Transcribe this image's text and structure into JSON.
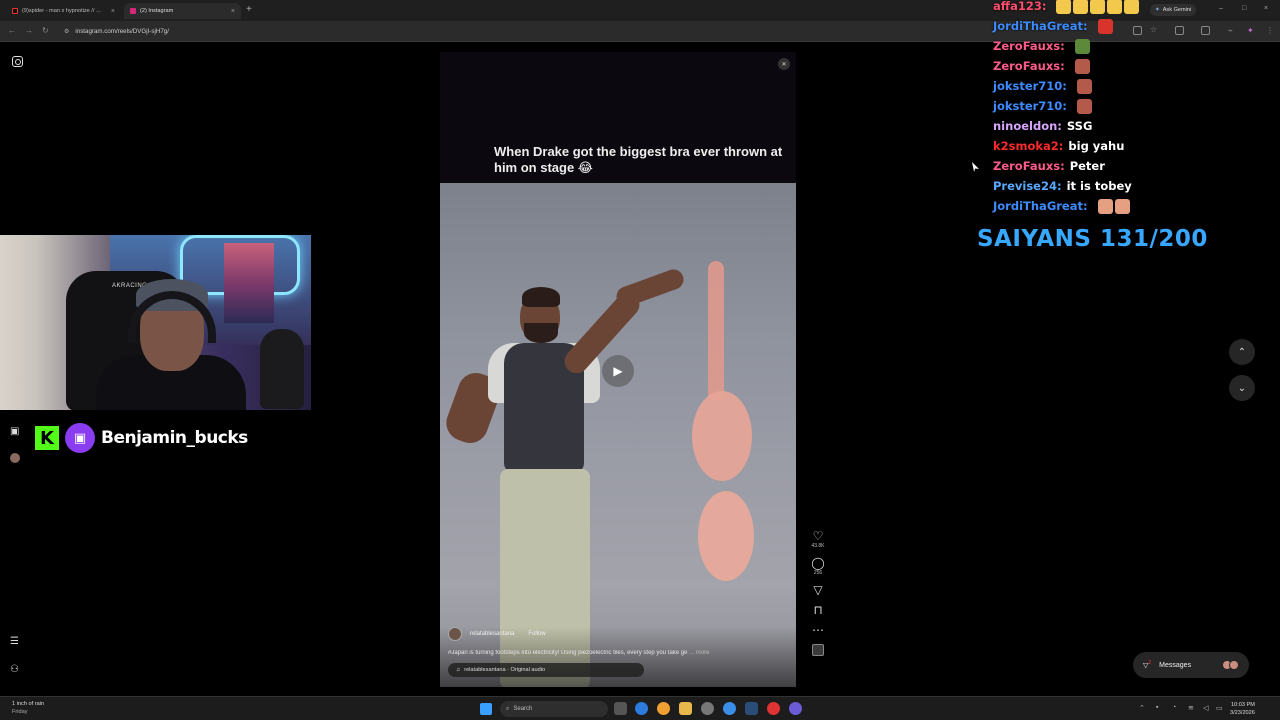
{
  "browser": {
    "tabs": [
      {
        "title": "(9)spider - man x hypnotize // ..."
      },
      {
        "title": "(2) Instagram"
      }
    ],
    "new_tab": "+",
    "ask_gemini": "Ask Gemini",
    "url": "instagram.com/reels/DVGjI-sjH7g/"
  },
  "reel": {
    "caption": "When Drake got the biggest bra ever thrown at him on stage 😂",
    "username": "relatablesantana",
    "follow_label": "Follow",
    "description": "#Japan is turning footsteps into electricity! Using piezoelectric tiles, every step you take ge",
    "more_label": "... more",
    "audio": "relatablesantana · Original audio",
    "likes": "43.8K",
    "comments": "256"
  },
  "stream": {
    "handle": "Benjamin_bucks",
    "kick_letter": "K",
    "chair_brand": "AKRACING"
  },
  "chat": [
    {
      "user": "affa123:",
      "color": "#ff4d6d",
      "msg": "",
      "emotes": [
        "#f2c94c",
        "#f2c94c",
        "#f2c94c",
        "#f2c94c",
        "#f2c94c"
      ]
    },
    {
      "user": "JordiThaGreat:",
      "color": "#3d8bff",
      "msg": "",
      "emotes": [
        "#d9342b"
      ]
    },
    {
      "user": "ZeroFauxs:",
      "color": "#ff5b8a",
      "msg": "",
      "emotes": [
        "#5c8a3a"
      ]
    },
    {
      "user": "ZeroFauxs:",
      "color": "#ff5b8a",
      "msg": "",
      "emotes": [
        "#b45a4a"
      ]
    },
    {
      "user": "jokster710:",
      "color": "#3d8bff",
      "msg": "",
      "emotes": [
        "#b45a4a"
      ]
    },
    {
      "user": "jokster710:",
      "color": "#3d8bff",
      "msg": "",
      "emotes": [
        "#b45a4a"
      ]
    },
    {
      "user": "ninoeldon:",
      "color": "#d6a6ff",
      "msg": "SSG",
      "emotes": []
    },
    {
      "user": "k2smoka2:",
      "color": "#ff2a2a",
      "msg": "big yahu",
      "emotes": []
    },
    {
      "user": "ZeroFauxs:",
      "color": "#ff5b8a",
      "msg": "Peter",
      "emotes": []
    },
    {
      "user": "Previse24:",
      "color": "#5aa9ff",
      "msg": "it is tobey",
      "emotes": []
    },
    {
      "user": "JordiThaGreat:",
      "color": "#3d8bff",
      "msg": "",
      "emotes": [
        "#e4a080",
        "#e4a080"
      ]
    }
  ],
  "saiyans": "SAIYANS 131/200",
  "messages_label": "Messages",
  "messages_badge": "2",
  "taskbar": {
    "weather_line1": "1 inch of rain",
    "weather_line2": "Friday",
    "search_label": "Search",
    "time": "10:03 PM",
    "date": "3/23/2026"
  },
  "colors": {
    "accent_blue": "#38a8ff",
    "kick_green": "#53fc18",
    "twitch_purple": "#8a3cf0"
  }
}
